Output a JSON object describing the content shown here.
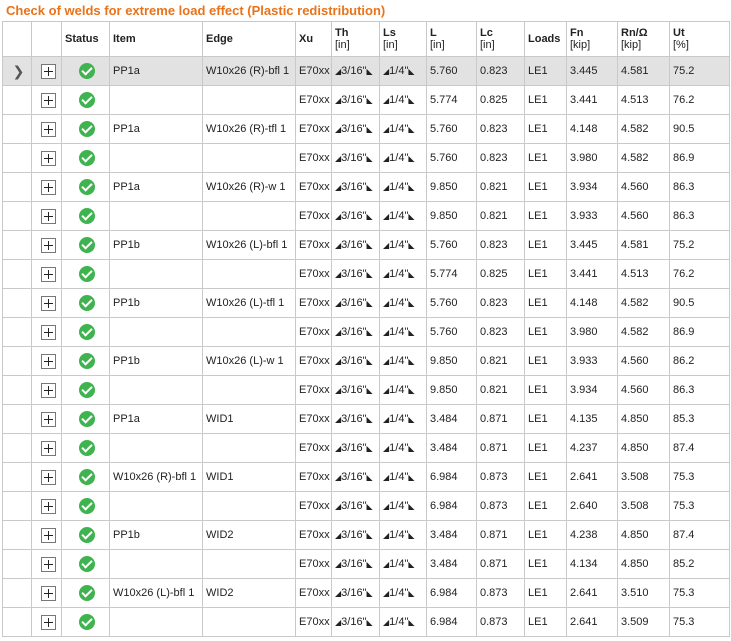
{
  "title": "Check of welds for extreme load effect (Plastic redistribution)",
  "columns": [
    {
      "label": "",
      "unit": ""
    },
    {
      "label": "",
      "unit": ""
    },
    {
      "label": "Status",
      "unit": ""
    },
    {
      "label": "Item",
      "unit": ""
    },
    {
      "label": "Edge",
      "unit": ""
    },
    {
      "label": "Xu",
      "unit": ""
    },
    {
      "label": "Th",
      "unit": "[in]"
    },
    {
      "label": "Ls",
      "unit": "[in]"
    },
    {
      "label": "L",
      "unit": "[in]"
    },
    {
      "label": "Lc",
      "unit": "[in]"
    },
    {
      "label": "Loads",
      "unit": ""
    },
    {
      "label": "Fn",
      "unit": "[kip]"
    },
    {
      "label": "Rn/Ω",
      "unit": "[kip]"
    },
    {
      "label": "Ut",
      "unit": "[%]"
    }
  ],
  "rows": [
    {
      "selected": true,
      "item": "PP1a",
      "edge": "W10x26 (R)-bfl 1",
      "xu": "E70xx",
      "th": "3/16\"",
      "ls": "1/4\"",
      "l": "5.760",
      "lc": "0.823",
      "loads": "LE1",
      "fn": "3.445",
      "rn": "4.581",
      "ut": "75.2"
    },
    {
      "selected": false,
      "item": "",
      "edge": "",
      "xu": "E70xx",
      "th": "3/16\"",
      "ls": "1/4\"",
      "l": "5.774",
      "lc": "0.825",
      "loads": "LE1",
      "fn": "3.441",
      "rn": "4.513",
      "ut": "76.2"
    },
    {
      "selected": false,
      "item": "PP1a",
      "edge": "W10x26 (R)-tfl 1",
      "xu": "E70xx",
      "th": "3/16\"",
      "ls": "1/4\"",
      "l": "5.760",
      "lc": "0.823",
      "loads": "LE1",
      "fn": "4.148",
      "rn": "4.582",
      "ut": "90.5"
    },
    {
      "selected": false,
      "item": "",
      "edge": "",
      "xu": "E70xx",
      "th": "3/16\"",
      "ls": "1/4\"",
      "l": "5.760",
      "lc": "0.823",
      "loads": "LE1",
      "fn": "3.980",
      "rn": "4.582",
      "ut": "86.9"
    },
    {
      "selected": false,
      "item": "PP1a",
      "edge": "W10x26 (R)-w 1",
      "xu": "E70xx",
      "th": "3/16\"",
      "ls": "1/4\"",
      "l": "9.850",
      "lc": "0.821",
      "loads": "LE1",
      "fn": "3.934",
      "rn": "4.560",
      "ut": "86.3"
    },
    {
      "selected": false,
      "item": "",
      "edge": "",
      "xu": "E70xx",
      "th": "3/16\"",
      "ls": "1/4\"",
      "l": "9.850",
      "lc": "0.821",
      "loads": "LE1",
      "fn": "3.933",
      "rn": "4.560",
      "ut": "86.3"
    },
    {
      "selected": false,
      "item": "PP1b",
      "edge": "W10x26 (L)-bfl 1",
      "xu": "E70xx",
      "th": "3/16\"",
      "ls": "1/4\"",
      "l": "5.760",
      "lc": "0.823",
      "loads": "LE1",
      "fn": "3.445",
      "rn": "4.581",
      "ut": "75.2"
    },
    {
      "selected": false,
      "item": "",
      "edge": "",
      "xu": "E70xx",
      "th": "3/16\"",
      "ls": "1/4\"",
      "l": "5.774",
      "lc": "0.825",
      "loads": "LE1",
      "fn": "3.441",
      "rn": "4.513",
      "ut": "76.2"
    },
    {
      "selected": false,
      "item": "PP1b",
      "edge": "W10x26 (L)-tfl 1",
      "xu": "E70xx",
      "th": "3/16\"",
      "ls": "1/4\"",
      "l": "5.760",
      "lc": "0.823",
      "loads": "LE1",
      "fn": "4.148",
      "rn": "4.582",
      "ut": "90.5"
    },
    {
      "selected": false,
      "item": "",
      "edge": "",
      "xu": "E70xx",
      "th": "3/16\"",
      "ls": "1/4\"",
      "l": "5.760",
      "lc": "0.823",
      "loads": "LE1",
      "fn": "3.980",
      "rn": "4.582",
      "ut": "86.9"
    },
    {
      "selected": false,
      "item": "PP1b",
      "edge": "W10x26 (L)-w 1",
      "xu": "E70xx",
      "th": "3/16\"",
      "ls": "1/4\"",
      "l": "9.850",
      "lc": "0.821",
      "loads": "LE1",
      "fn": "3.933",
      "rn": "4.560",
      "ut": "86.2"
    },
    {
      "selected": false,
      "item": "",
      "edge": "",
      "xu": "E70xx",
      "th": "3/16\"",
      "ls": "1/4\"",
      "l": "9.850",
      "lc": "0.821",
      "loads": "LE1",
      "fn": "3.934",
      "rn": "4.560",
      "ut": "86.3"
    },
    {
      "selected": false,
      "item": "PP1a",
      "edge": "WID1",
      "xu": "E70xx",
      "th": "3/16\"",
      "ls": "1/4\"",
      "l": "3.484",
      "lc": "0.871",
      "loads": "LE1",
      "fn": "4.135",
      "rn": "4.850",
      "ut": "85.3"
    },
    {
      "selected": false,
      "item": "",
      "edge": "",
      "xu": "E70xx",
      "th": "3/16\"",
      "ls": "1/4\"",
      "l": "3.484",
      "lc": "0.871",
      "loads": "LE1",
      "fn": "4.237",
      "rn": "4.850",
      "ut": "87.4"
    },
    {
      "selected": false,
      "item": "W10x26 (R)-bfl 1",
      "edge": "WID1",
      "xu": "E70xx",
      "th": "3/16\"",
      "ls": "1/4\"",
      "l": "6.984",
      "lc": "0.873",
      "loads": "LE1",
      "fn": "2.641",
      "rn": "3.508",
      "ut": "75.3"
    },
    {
      "selected": false,
      "item": "",
      "edge": "",
      "xu": "E70xx",
      "th": "3/16\"",
      "ls": "1/4\"",
      "l": "6.984",
      "lc": "0.873",
      "loads": "LE1",
      "fn": "2.640",
      "rn": "3.508",
      "ut": "75.3"
    },
    {
      "selected": false,
      "item": "PP1b",
      "edge": "WID2",
      "xu": "E70xx",
      "th": "3/16\"",
      "ls": "1/4\"",
      "l": "3.484",
      "lc": "0.871",
      "loads": "LE1",
      "fn": "4.238",
      "rn": "4.850",
      "ut": "87.4"
    },
    {
      "selected": false,
      "item": "",
      "edge": "",
      "xu": "E70xx",
      "th": "3/16\"",
      "ls": "1/4\"",
      "l": "3.484",
      "lc": "0.871",
      "loads": "LE1",
      "fn": "4.134",
      "rn": "4.850",
      "ut": "85.2"
    },
    {
      "selected": false,
      "item": "W10x26 (L)-bfl 1",
      "edge": "WID2",
      "xu": "E70xx",
      "th": "3/16\"",
      "ls": "1/4\"",
      "l": "6.984",
      "lc": "0.873",
      "loads": "LE1",
      "fn": "2.641",
      "rn": "3.510",
      "ut": "75.3"
    },
    {
      "selected": false,
      "item": "",
      "edge": "",
      "xu": "E70xx",
      "th": "3/16\"",
      "ls": "1/4\"",
      "l": "6.984",
      "lc": "0.873",
      "loads": "LE1",
      "fn": "2.641",
      "rn": "3.509",
      "ut": "75.3"
    }
  ],
  "icons": {
    "row_selector": "row-pointer-icon",
    "expand": "expand-plus-icon",
    "status_ok": "check-circle-icon",
    "weld_symbol": "weld-triangle-icon"
  },
  "colors": {
    "title": "#e8731a",
    "status_ok": "#3fb34f",
    "selected_row": "#e2e2e2"
  }
}
